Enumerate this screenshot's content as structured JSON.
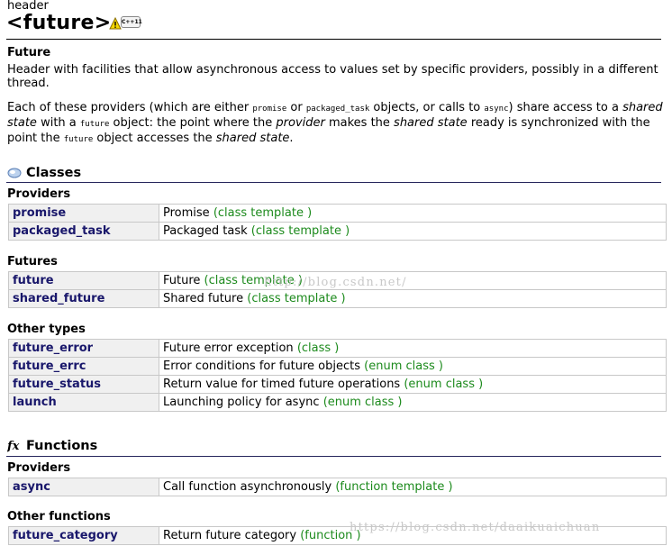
{
  "header": {
    "kind": "header",
    "title": "<future>",
    "badge": "C++11",
    "icons": [
      "warning-icon",
      "cpp11-badge"
    ]
  },
  "intro": {
    "name": "Future",
    "p1": "Header with facilities that allow asynchronous access to values set by specific providers, possibly in a different thread.",
    "p2": {
      "t1": "Each of these providers (which are either ",
      "c1": "promise",
      "t2": " or ",
      "c2": "packaged_task",
      "t3": " objects, or calls to ",
      "c3": "async",
      "t4": ") share access to a ",
      "e1": "shared state",
      "t5": " with a ",
      "c4": "future",
      "t6": " object: the point where the ",
      "e2": "provider",
      "t7": " makes the ",
      "e3": "shared state",
      "t8": " ready is synchronized with the point the ",
      "c5": "future",
      "t9": " object accesses the ",
      "e4": "shared state",
      "t10": "."
    }
  },
  "sections": {
    "classes": {
      "title": "Classes",
      "icon": "classes-icon",
      "groups": [
        {
          "label": "Providers",
          "rows": [
            {
              "name": "promise",
              "desc": "Promise",
              "kind": "(class template )"
            },
            {
              "name": "packaged_task",
              "desc": "Packaged task",
              "kind": "(class template )"
            }
          ]
        },
        {
          "label": "Futures",
          "rows": [
            {
              "name": "future",
              "desc": "Future",
              "kind": "(class template )"
            },
            {
              "name": "shared_future",
              "desc": "Shared future",
              "kind": "(class template )"
            }
          ]
        },
        {
          "label": "Other types",
          "rows": [
            {
              "name": "future_error",
              "desc": "Future error exception",
              "kind": "(class )"
            },
            {
              "name": "future_errc",
              "desc": "Error conditions for future objects",
              "kind": "(enum class )"
            },
            {
              "name": "future_status",
              "desc": "Return value for timed future operations",
              "kind": "(enum class )"
            },
            {
              "name": "launch",
              "desc": "Launching policy for async",
              "kind": "(enum class )"
            }
          ]
        }
      ]
    },
    "functions": {
      "title": "Functions",
      "icon": "fx-icon",
      "groups": [
        {
          "label": "Providers",
          "rows": [
            {
              "name": "async",
              "desc": "Call function asynchronously",
              "kind": "(function template )"
            }
          ]
        },
        {
          "label": "Other functions",
          "rows": [
            {
              "name": "future_category",
              "desc": "Return future category",
              "kind": "(function )"
            }
          ]
        }
      ]
    }
  },
  "watermarks": {
    "w1": "http://blog.csdn.net/",
    "w2": "https://blog.csdn.net/daaikuaichuan"
  }
}
